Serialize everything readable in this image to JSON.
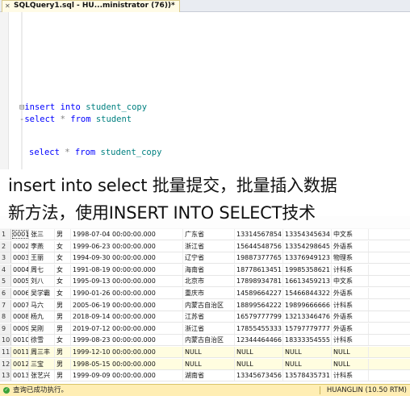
{
  "tab": {
    "title": "SQLQuery1.sql - HU...ministrator (76))*",
    "close_glyph": "✕"
  },
  "editor": {
    "lines": [
      [
        {
          "t": "⊟",
          "c": "fold"
        },
        {
          "t": "insert into ",
          "c": "kw"
        },
        {
          "t": "student_copy",
          "c": "tbl"
        }
      ],
      [
        {
          "t": "-",
          "c": "fold"
        },
        {
          "t": "select ",
          "c": "kw"
        },
        {
          "t": "* ",
          "c": "kwg"
        },
        {
          "t": "from ",
          "c": "kw"
        },
        {
          "t": "student",
          "c": "tbl"
        }
      ],
      [
        {
          "t": "select ",
          "c": "kw"
        },
        {
          "t": "* ",
          "c": "kwg"
        },
        {
          "t": "from ",
          "c": "kw"
        },
        {
          "t": "student_copy",
          "c": "tbl"
        }
      ]
    ]
  },
  "caption": {
    "line1": "insert into select 批量提交，批量插入数据",
    "line2": "新方法，使用INSERT INTO SELECT技术"
  },
  "results": {
    "rows": [
      [
        "1",
        "0001",
        "张三",
        "男",
        "1998-07-04 00:00:00.000",
        "广东省",
        "13314567854",
        "13354345634",
        "中文系"
      ],
      [
        "2",
        "0002",
        "李燕",
        "女",
        "1999-06-23 00:00:00.000",
        "浙江省",
        "15644548756",
        "13354298645",
        "外语系"
      ],
      [
        "3",
        "0003",
        "王丽",
        "女",
        "1994-09-30 00:00:00.000",
        "辽宁省",
        "19887377765",
        "13376949123",
        "物理系"
      ],
      [
        "4",
        "0004",
        "周七",
        "女",
        "1991-08-19 00:00:00.000",
        "海南省",
        "18778613451",
        "19985358621",
        "计科系"
      ],
      [
        "5",
        "0005",
        "刘八",
        "女",
        "1995-09-13 00:00:00.000",
        "北京市",
        "17898934781",
        "16613459213",
        "中文系"
      ],
      [
        "6",
        "0006",
        "吴学霸",
        "女",
        "1990-01-26 00:00:00.000",
        "重庆市",
        "14589664227",
        "15466844322",
        "外语系"
      ],
      [
        "7",
        "0007",
        "马六",
        "男",
        "2005-06-19 00:00:00.000",
        "内蒙古自治区",
        "18899564222",
        "19899666666",
        "计科系"
      ],
      [
        "8",
        "0008",
        "杨九",
        "男",
        "2018-09-14 00:00:00.000",
        "江苏省",
        "16579777799",
        "13213346476",
        "外语系"
      ],
      [
        "9",
        "0009",
        "吴刚",
        "男",
        "2019-07-12 00:00:00.000",
        "浙江省",
        "17855455333",
        "15797779777",
        "外语系"
      ],
      [
        "10",
        "0010",
        "徐雪",
        "女",
        "1999-08-23 00:00:00.000",
        "内蒙古自治区",
        "12344464466",
        "18333354555",
        "计科系"
      ],
      [
        "11",
        "0011",
        "周三丰",
        "男",
        "1999-12-10 00:00:00.000",
        "NULL",
        "NULL",
        "NULL",
        "NULL"
      ],
      [
        "12",
        "0012",
        "三宝",
        "男",
        "1998-05-15 00:00:00.000",
        "NULL",
        "NULL",
        "NULL",
        "NULL"
      ],
      [
        "13",
        "0013",
        "张艺兴",
        "男",
        "1999-09-09 00:00:00.000",
        "湖南省",
        "13345673456",
        "13578435731",
        "计科系"
      ]
    ]
  },
  "status": {
    "icon_glyph": "✓",
    "message": "查询已成功执行。",
    "server": "HUANGLIN (10.50 RTM)"
  }
}
